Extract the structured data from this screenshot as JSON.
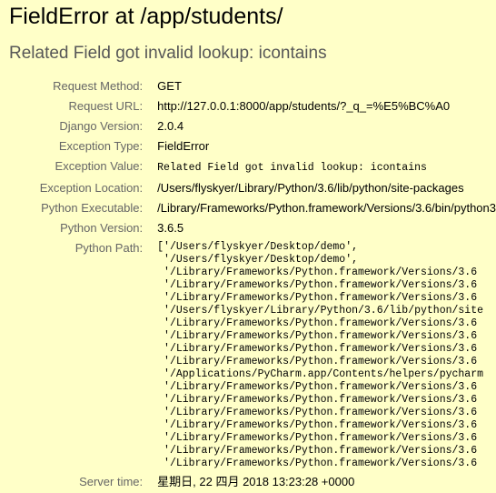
{
  "title": "FieldError at /app/students/",
  "subtitle": "Related Field got invalid lookup: icontains",
  "meta": {
    "request_method_label": "Request Method:",
    "request_method": "GET",
    "request_url_label": "Request URL:",
    "request_url": "http://127.0.0.1:8000/app/students/?_q_=%E5%BC%A0",
    "django_version_label": "Django Version:",
    "django_version": "2.0.4",
    "exception_type_label": "Exception Type:",
    "exception_type": "FieldError",
    "exception_value_label": "Exception Value:",
    "exception_value": "Related Field got invalid lookup: icontains",
    "exception_location_label": "Exception Location:",
    "exception_location": "/Users/flyskyer/Library/Python/3.6/lib/python/site-packages",
    "python_executable_label": "Python Executable:",
    "python_executable": "/Library/Frameworks/Python.framework/Versions/3.6/bin/python3",
    "python_version_label": "Python Version:",
    "python_version": "3.6.5",
    "python_path_label": "Python Path:",
    "python_path": [
      "['/Users/flyskyer/Desktop/demo',",
      " '/Users/flyskyer/Desktop/demo',",
      " '/Library/Frameworks/Python.framework/Versions/3.6",
      " '/Library/Frameworks/Python.framework/Versions/3.6",
      " '/Library/Frameworks/Python.framework/Versions/3.6",
      " '/Users/flyskyer/Library/Python/3.6/lib/python/site",
      " '/Library/Frameworks/Python.framework/Versions/3.6",
      " '/Library/Frameworks/Python.framework/Versions/3.6",
      " '/Library/Frameworks/Python.framework/Versions/3.6",
      " '/Library/Frameworks/Python.framework/Versions/3.6",
      " '/Applications/PyCharm.app/Contents/helpers/pycharm",
      " '/Library/Frameworks/Python.framework/Versions/3.6",
      " '/Library/Frameworks/Python.framework/Versions/3.6",
      " '/Library/Frameworks/Python.framework/Versions/3.6",
      " '/Library/Frameworks/Python.framework/Versions/3.6",
      " '/Library/Frameworks/Python.framework/Versions/3.6",
      " '/Library/Frameworks/Python.framework/Versions/3.6",
      " '/Library/Frameworks/Python.framework/Versions/3.6"
    ],
    "server_time_label": "Server time:",
    "server_time": "星期日, 22 四月 2018 13:23:28 +0000"
  }
}
